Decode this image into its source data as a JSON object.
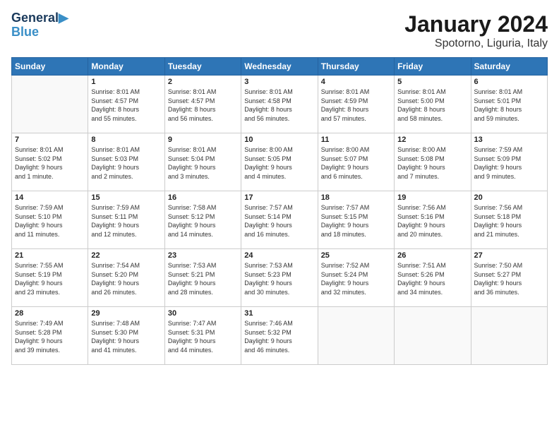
{
  "header": {
    "logo_line1": "General",
    "logo_line2": "Blue",
    "month": "January 2024",
    "location": "Spotorno, Liguria, Italy"
  },
  "weekdays": [
    "Sunday",
    "Monday",
    "Tuesday",
    "Wednesday",
    "Thursday",
    "Friday",
    "Saturday"
  ],
  "weeks": [
    [
      {
        "day": "",
        "info": ""
      },
      {
        "day": "1",
        "info": "Sunrise: 8:01 AM\nSunset: 4:57 PM\nDaylight: 8 hours\nand 55 minutes."
      },
      {
        "day": "2",
        "info": "Sunrise: 8:01 AM\nSunset: 4:57 PM\nDaylight: 8 hours\nand 56 minutes."
      },
      {
        "day": "3",
        "info": "Sunrise: 8:01 AM\nSunset: 4:58 PM\nDaylight: 8 hours\nand 56 minutes."
      },
      {
        "day": "4",
        "info": "Sunrise: 8:01 AM\nSunset: 4:59 PM\nDaylight: 8 hours\nand 57 minutes."
      },
      {
        "day": "5",
        "info": "Sunrise: 8:01 AM\nSunset: 5:00 PM\nDaylight: 8 hours\nand 58 minutes."
      },
      {
        "day": "6",
        "info": "Sunrise: 8:01 AM\nSunset: 5:01 PM\nDaylight: 8 hours\nand 59 minutes."
      }
    ],
    [
      {
        "day": "7",
        "info": "Sunrise: 8:01 AM\nSunset: 5:02 PM\nDaylight: 9 hours\nand 1 minute."
      },
      {
        "day": "8",
        "info": "Sunrise: 8:01 AM\nSunset: 5:03 PM\nDaylight: 9 hours\nand 2 minutes."
      },
      {
        "day": "9",
        "info": "Sunrise: 8:01 AM\nSunset: 5:04 PM\nDaylight: 9 hours\nand 3 minutes."
      },
      {
        "day": "10",
        "info": "Sunrise: 8:00 AM\nSunset: 5:05 PM\nDaylight: 9 hours\nand 4 minutes."
      },
      {
        "day": "11",
        "info": "Sunrise: 8:00 AM\nSunset: 5:07 PM\nDaylight: 9 hours\nand 6 minutes."
      },
      {
        "day": "12",
        "info": "Sunrise: 8:00 AM\nSunset: 5:08 PM\nDaylight: 9 hours\nand 7 minutes."
      },
      {
        "day": "13",
        "info": "Sunrise: 7:59 AM\nSunset: 5:09 PM\nDaylight: 9 hours\nand 9 minutes."
      }
    ],
    [
      {
        "day": "14",
        "info": "Sunrise: 7:59 AM\nSunset: 5:10 PM\nDaylight: 9 hours\nand 11 minutes."
      },
      {
        "day": "15",
        "info": "Sunrise: 7:59 AM\nSunset: 5:11 PM\nDaylight: 9 hours\nand 12 minutes."
      },
      {
        "day": "16",
        "info": "Sunrise: 7:58 AM\nSunset: 5:12 PM\nDaylight: 9 hours\nand 14 minutes."
      },
      {
        "day": "17",
        "info": "Sunrise: 7:57 AM\nSunset: 5:14 PM\nDaylight: 9 hours\nand 16 minutes."
      },
      {
        "day": "18",
        "info": "Sunrise: 7:57 AM\nSunset: 5:15 PM\nDaylight: 9 hours\nand 18 minutes."
      },
      {
        "day": "19",
        "info": "Sunrise: 7:56 AM\nSunset: 5:16 PM\nDaylight: 9 hours\nand 20 minutes."
      },
      {
        "day": "20",
        "info": "Sunrise: 7:56 AM\nSunset: 5:18 PM\nDaylight: 9 hours\nand 21 minutes."
      }
    ],
    [
      {
        "day": "21",
        "info": "Sunrise: 7:55 AM\nSunset: 5:19 PM\nDaylight: 9 hours\nand 23 minutes."
      },
      {
        "day": "22",
        "info": "Sunrise: 7:54 AM\nSunset: 5:20 PM\nDaylight: 9 hours\nand 26 minutes."
      },
      {
        "day": "23",
        "info": "Sunrise: 7:53 AM\nSunset: 5:21 PM\nDaylight: 9 hours\nand 28 minutes."
      },
      {
        "day": "24",
        "info": "Sunrise: 7:53 AM\nSunset: 5:23 PM\nDaylight: 9 hours\nand 30 minutes."
      },
      {
        "day": "25",
        "info": "Sunrise: 7:52 AM\nSunset: 5:24 PM\nDaylight: 9 hours\nand 32 minutes."
      },
      {
        "day": "26",
        "info": "Sunrise: 7:51 AM\nSunset: 5:26 PM\nDaylight: 9 hours\nand 34 minutes."
      },
      {
        "day": "27",
        "info": "Sunrise: 7:50 AM\nSunset: 5:27 PM\nDaylight: 9 hours\nand 36 minutes."
      }
    ],
    [
      {
        "day": "28",
        "info": "Sunrise: 7:49 AM\nSunset: 5:28 PM\nDaylight: 9 hours\nand 39 minutes."
      },
      {
        "day": "29",
        "info": "Sunrise: 7:48 AM\nSunset: 5:30 PM\nDaylight: 9 hours\nand 41 minutes."
      },
      {
        "day": "30",
        "info": "Sunrise: 7:47 AM\nSunset: 5:31 PM\nDaylight: 9 hours\nand 44 minutes."
      },
      {
        "day": "31",
        "info": "Sunrise: 7:46 AM\nSunset: 5:32 PM\nDaylight: 9 hours\nand 46 minutes."
      },
      {
        "day": "",
        "info": ""
      },
      {
        "day": "",
        "info": ""
      },
      {
        "day": "",
        "info": ""
      }
    ]
  ]
}
